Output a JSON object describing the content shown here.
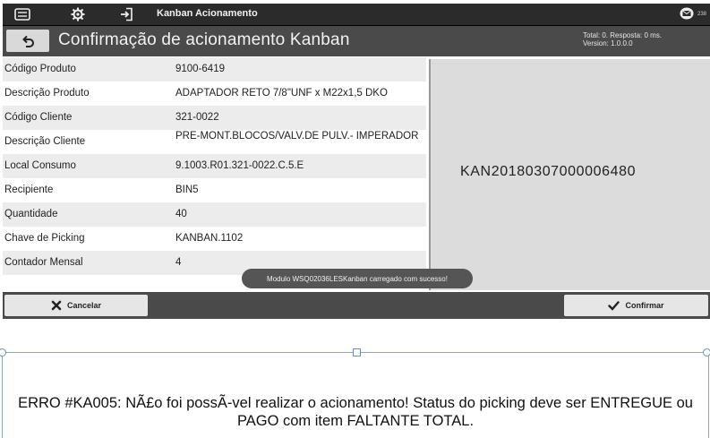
{
  "window": {
    "app_title": "Kanban Acionamento",
    "mail_count": "238"
  },
  "header": {
    "title": "Confirmação de acionamento Kanban",
    "stats_line1": "Total: 0. Resposta: 0 ms.",
    "stats_line2": "Version: 1.0.0.0"
  },
  "details": [
    {
      "label": "Código Produto",
      "value": "9100-6419"
    },
    {
      "label": "Descrição Produto",
      "value": "ADAPTADOR RETO 7/8\"UNF x M22x1,5 DKO"
    },
    {
      "label": "Código Cliente",
      "value": "321-0022"
    },
    {
      "label": "Descrição Cliente",
      "value": "PRE-MONT.BLOCOS/VALV.DE PULV.- IMPERADOR"
    },
    {
      "label": "Local Consumo",
      "value": "9.1003.R01.321-0022.C.5.E"
    },
    {
      "label": "Recipiente",
      "value": "BIN5"
    },
    {
      "label": "Quantidade",
      "value": "40"
    },
    {
      "label": "Chave de Picking",
      "value": "KANBAN.1102"
    },
    {
      "label": "Contador Mensal",
      "value": "4"
    }
  ],
  "kanban_code": "KAN20180307000006480",
  "toast": "Modulo WSQ02036LESKanban carregado com sucesso!",
  "buttons": {
    "cancel": "Cancelar",
    "confirm": "Confirmar"
  },
  "error_message": "ERRO #KA005: NÃ£o foi possÃ-vel realizar o acionamento! Status do picking deve ser ENTREGUE ou PAGO com item FALTANTE TOTAL.",
  "icons": {
    "menu": "menu-icon",
    "settings": "gear-icon",
    "login": "login-icon",
    "mail": "mail-icon",
    "back": "back-arrow-icon",
    "cancel": "close-icon",
    "confirm": "check-icon"
  },
  "colors": {
    "topbar": "#2b2b2b",
    "header": "#4a4a4a",
    "button": "#e6e6e6",
    "panel": "#dcdcdc"
  }
}
